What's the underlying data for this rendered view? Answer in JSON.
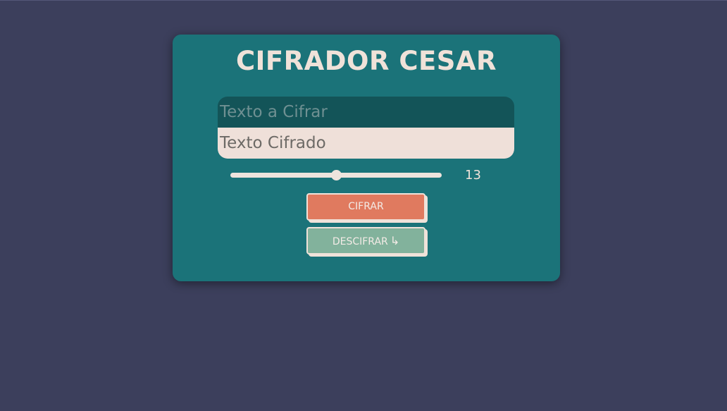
{
  "colors": {
    "background": "#3c3f5c",
    "card": "#1b7379",
    "input_dark": "#135458",
    "input_light": "#efe0d9",
    "accent_cifrar": "#e07a5f",
    "accent_descifrar": "#82b29c",
    "text_light": "#f0e2d9"
  },
  "app": {
    "title": "CIFRADOR CESAR"
  },
  "input": {
    "value": "",
    "placeholder": "Texto a Cifrar"
  },
  "output": {
    "value": "",
    "placeholder": "Texto Cifrado"
  },
  "shift": {
    "value": 13,
    "min": 0,
    "max": 26,
    "label": "13"
  },
  "buttons": {
    "cifrar_label": "CIFRAR",
    "descifrar_label": "DESCIFRAR",
    "descifrar_icon": "arrow-turn-right-icon"
  }
}
